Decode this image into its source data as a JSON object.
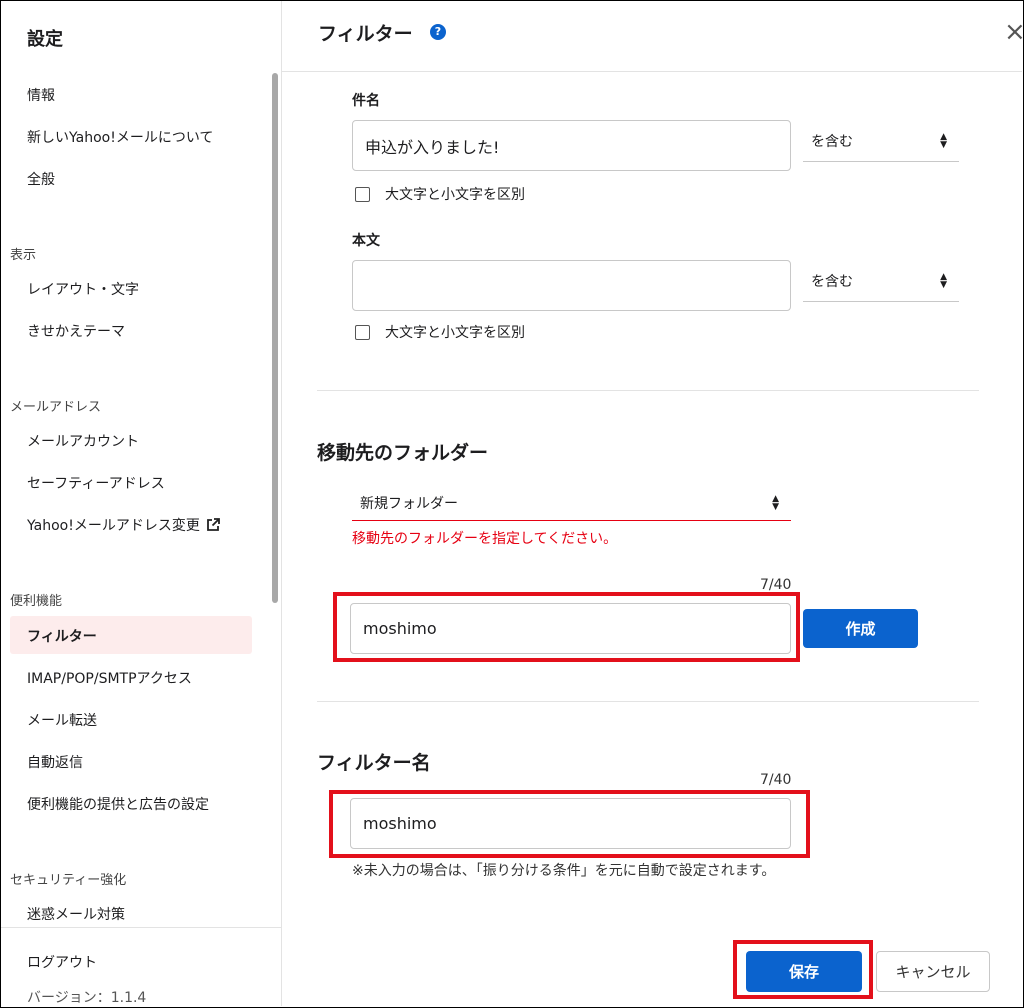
{
  "sidebar": {
    "title": "設定",
    "items": [
      {
        "label": "情報"
      },
      {
        "label": "新しいYahoo!メールについて"
      },
      {
        "label": "全般"
      },
      {
        "label": "レイアウト・文字"
      },
      {
        "label": "きせかえテーマ"
      },
      {
        "label": "メールアカウント"
      },
      {
        "label": "セーフティーアドレス"
      },
      {
        "label": "Yahoo!メールアドレス変更"
      },
      {
        "label": "フィルター"
      },
      {
        "label": "IMAP/POP/SMTPアクセス"
      },
      {
        "label": "メール転送"
      },
      {
        "label": "自動返信"
      },
      {
        "label": "便利機能の提供と広告の設定"
      },
      {
        "label": "迷惑メール対策"
      }
    ],
    "sections": [
      "表示",
      "メールアドレス",
      "便利機能",
      "セキュリティー強化"
    ],
    "logout": "ログアウト",
    "version": "バージョン：1.1.4",
    "active_item": "フィルター"
  },
  "header": {
    "title": "フィルター",
    "help": "?",
    "close": "×"
  },
  "subject": {
    "label": "件名",
    "value": "申込が入りました!",
    "condition": "を含む",
    "case_checkbox": "大文字と小文字を区別"
  },
  "body": {
    "label": "本文",
    "value": "",
    "condition": "を含む",
    "case_checkbox": "大文字と小文字を区別"
  },
  "folder": {
    "section_title": "移動先のフォルダー",
    "select_value": "新規フォルダー",
    "error": "移動先のフォルダーを指定してください。",
    "counter": "7/40",
    "new_name": "moshimo",
    "create_button": "作成"
  },
  "filter_name": {
    "section_title": "フィルター名",
    "counter": "7/40",
    "value": "moshimo",
    "hint": "※未入力の場合は、「振り分ける条件」を元に自動で設定されます。"
  },
  "footer": {
    "save_button": "保存",
    "cancel_button": "キャンセル"
  },
  "colors": {
    "primary": "#0b63ce",
    "error": "#e60012",
    "highlight": "#e3101b",
    "active_bg": "#fdecec"
  }
}
